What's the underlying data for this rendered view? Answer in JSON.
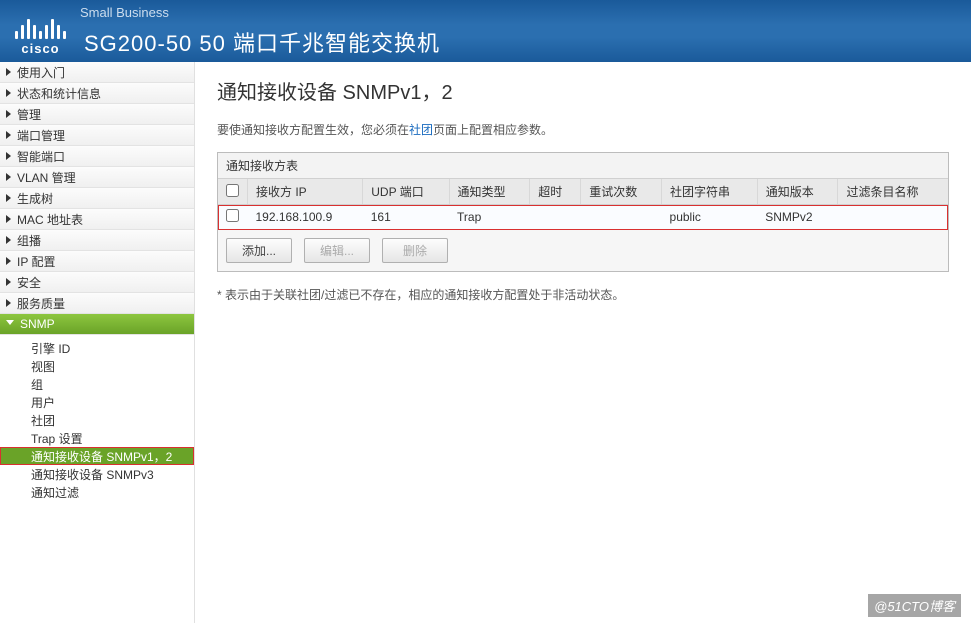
{
  "header": {
    "brand_small": "Small Business",
    "brand_logo_text": "cisco",
    "product_name": "SG200-50 50 端口千兆智能交换机"
  },
  "sidebar": {
    "items": [
      {
        "label": "使用入门"
      },
      {
        "label": "状态和统计信息"
      },
      {
        "label": "管理"
      },
      {
        "label": "端口管理"
      },
      {
        "label": "智能端口"
      },
      {
        "label": "VLAN 管理"
      },
      {
        "label": "生成树"
      },
      {
        "label": "MAC 地址表"
      },
      {
        "label": "组播"
      },
      {
        "label": "IP 配置"
      },
      {
        "label": "安全"
      },
      {
        "label": "服务质量"
      },
      {
        "label": "SNMP"
      }
    ],
    "snmp_sub": [
      {
        "label": "引擎 ID"
      },
      {
        "label": "视图"
      },
      {
        "label": "组"
      },
      {
        "label": "用户"
      },
      {
        "label": "社团"
      },
      {
        "label": "Trap 设置"
      },
      {
        "label": "通知接收设备 SNMPv1，2",
        "selected": true
      },
      {
        "label": "通知接收设备 SNMPv3"
      },
      {
        "label": "通知过滤"
      }
    ]
  },
  "main": {
    "title": "通知接收设备 SNMPv1，2",
    "notice_pre": "要使通知接收方配置生效，您必须在",
    "notice_link": "社团",
    "notice_post": "页面上配置相应参数。",
    "table": {
      "caption": "通知接收方表",
      "columns": [
        "",
        "接收方 IP",
        "UDP 端口",
        "通知类型",
        "超时",
        "重试次数",
        "社团字符串",
        "通知版本",
        "过滤条目名称"
      ],
      "rows": [
        {
          "checked": false,
          "ip": "192.168.100.9",
          "port": "161",
          "type": "Trap",
          "timeout": "",
          "retries": "",
          "community": "public",
          "version": "SNMPv2",
          "filter": ""
        }
      ]
    },
    "buttons": {
      "add": "添加...",
      "edit": "编辑...",
      "delete": "删除"
    },
    "footnote": "* 表示由于关联社团/过滤已不存在，相应的通知接收方配置处于非活动状态。"
  },
  "watermark": "@51CTO博客"
}
